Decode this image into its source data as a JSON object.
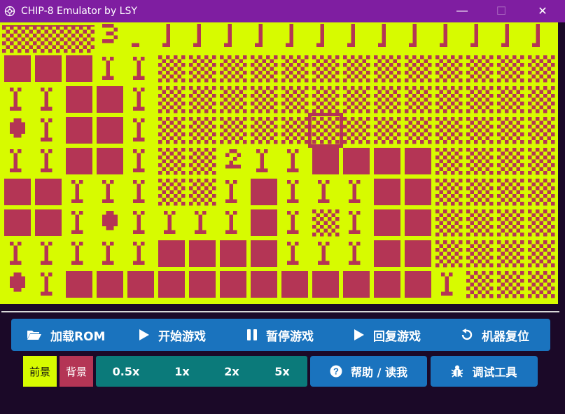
{
  "window": {
    "title": "CHIP-8 Emulator by LSY",
    "minimize_glyph": "—",
    "maximize_glyph": "☐",
    "close_glyph": "✕"
  },
  "colors": {
    "foreground": "#d7fb00",
    "background": "#b43555",
    "titlebar": "#7f1ea1",
    "panel": "#1a73be",
    "speed_group": "#0b7a7a"
  },
  "toolbar": {
    "items": [
      {
        "icon": "folder-open-icon",
        "label": "加载ROM"
      },
      {
        "icon": "play-icon",
        "label": "开始游戏"
      },
      {
        "icon": "pause-icon",
        "label": "暂停游戏"
      },
      {
        "icon": "play-icon",
        "label": "回复游戏"
      },
      {
        "icon": "undo-icon",
        "label": "机器复位"
      }
    ]
  },
  "colors_picker": {
    "foreground_label": "前景",
    "background_label": "背景"
  },
  "speed": {
    "options": [
      "0.5x",
      "1x",
      "2x",
      "5x"
    ]
  },
  "help": {
    "icon": "question-circle-icon",
    "label": "帮助 / 读我"
  },
  "debug": {
    "icon": "bug-icon",
    "label": "调试工具"
  },
  "screen": {
    "row0": [
      "C",
      "C",
      "C",
      "3",
      ".",
      "|",
      "|",
      "|",
      "|",
      "|",
      "|",
      "|",
      "|",
      "|",
      "|",
      "|",
      "|",
      "|"
    ],
    "board": [
      [
        "F",
        "F",
        "F",
        "1",
        "1",
        "C",
        "C",
        "C",
        "C",
        "C",
        "C",
        "C",
        "C",
        "C",
        "C",
        "C",
        "C",
        "C"
      ],
      [
        "1",
        "1",
        "F",
        "F",
        "1",
        "C",
        "C",
        "C",
        "C",
        "C",
        "C",
        "C",
        "C",
        "C",
        "C",
        "C",
        "C",
        "C"
      ],
      [
        "O",
        "1",
        "F",
        "F",
        "1",
        "C",
        "C",
        "C",
        "C",
        "C",
        "S",
        "C",
        "C",
        "C",
        "C",
        "C",
        "C",
        "C"
      ],
      [
        "1",
        "1",
        "F",
        "F",
        "1",
        "C",
        "C",
        "2",
        "1",
        "1",
        "F",
        "F",
        "F",
        "F",
        "C",
        "C",
        "C",
        "C"
      ],
      [
        "F",
        "F",
        "1",
        "1",
        "1",
        "C",
        "C",
        "1",
        "F",
        "1",
        "1",
        "1",
        "F",
        "F",
        "C",
        "C",
        "C",
        "C"
      ],
      [
        "F",
        "F",
        "1",
        "O",
        "1",
        "1",
        "1",
        "1",
        "F",
        "1",
        "C",
        "1",
        "F",
        "F",
        "C",
        "C",
        "C",
        "C"
      ],
      [
        "1",
        "1",
        "1",
        "1",
        "1",
        "F",
        "F",
        "F",
        "F",
        "1",
        "1",
        "1",
        "F",
        "F",
        "C",
        "C",
        "C",
        "C"
      ],
      [
        "O",
        "1",
        "F",
        "F",
        "F",
        "F",
        "F",
        "F",
        "F",
        "F",
        "F",
        "F",
        "F",
        "F",
        "1",
        "C",
        "C",
        "C"
      ]
    ]
  }
}
